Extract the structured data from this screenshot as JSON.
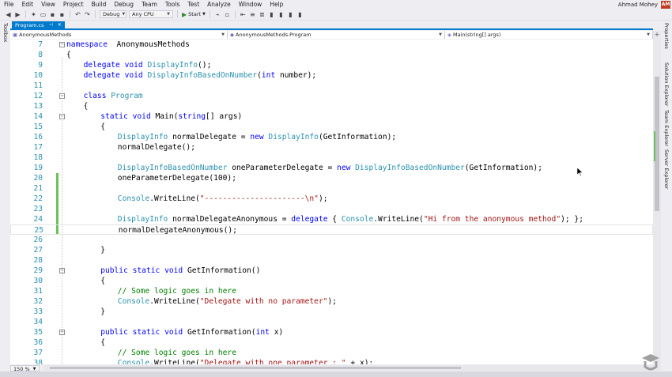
{
  "menu": {
    "items": [
      "File",
      "Edit",
      "View",
      "Project",
      "Build",
      "Debug",
      "Team",
      "Tools",
      "Test",
      "Analyze",
      "Window",
      "Help"
    ],
    "user_name": "Ahmad Mohey",
    "user_initials": "AM"
  },
  "toolbar": {
    "config": "Debug",
    "platform": "Any CPU",
    "start_label": "Start"
  },
  "side_tabs": {
    "left": [
      "Toolbox"
    ],
    "right": [
      "Properties",
      "Solution Explorer",
      "Team Explorer",
      "Server Explorer"
    ]
  },
  "document_tab": {
    "label": "Program.cs"
  },
  "nav": {
    "project": "AnonymousMethods",
    "type": "AnonymousMethods.Program",
    "member": "Main(string[] args)"
  },
  "editor": {
    "zoom": "150 %",
    "lines": [
      {
        "n": "7",
        "i": 0,
        "t": [
          [
            "kw",
            "namespace"
          ],
          [
            "",
            "  AnonymousMethods"
          ]
        ]
      },
      {
        "n": "8",
        "i": 0,
        "t": [
          [
            "",
            "{"
          ]
        ]
      },
      {
        "n": "9",
        "i": 1,
        "t": [
          [
            "kw",
            "delegate"
          ],
          [
            "",
            " "
          ],
          [
            "kw",
            "void"
          ],
          [
            "",
            " "
          ],
          [
            "ty",
            "DisplayInfo"
          ],
          [
            "",
            "();"
          ]
        ]
      },
      {
        "n": "10",
        "i": 1,
        "t": [
          [
            "kw",
            "delegate"
          ],
          [
            "",
            " "
          ],
          [
            "kw",
            "void"
          ],
          [
            "",
            " "
          ],
          [
            "ty",
            "DisplayInfoBasedOnNumber"
          ],
          [
            "",
            "("
          ],
          [
            "kw",
            "int"
          ],
          [
            "",
            " number);"
          ]
        ]
      },
      {
        "n": "11",
        "i": 0,
        "t": []
      },
      {
        "n": "12",
        "i": 1,
        "t": [
          [
            "kw",
            "class"
          ],
          [
            "",
            " "
          ],
          [
            "ty",
            "Program"
          ]
        ]
      },
      {
        "n": "13",
        "i": 1,
        "t": [
          [
            "",
            "{"
          ]
        ]
      },
      {
        "n": "14",
        "i": 2,
        "t": [
          [
            "kw",
            "static"
          ],
          [
            "",
            " "
          ],
          [
            "kw",
            "void"
          ],
          [
            "",
            " Main("
          ],
          [
            "kw",
            "string"
          ],
          [
            "",
            "[] args)"
          ]
        ]
      },
      {
        "n": "15",
        "i": 2,
        "t": [
          [
            "",
            "{"
          ]
        ]
      },
      {
        "n": "16",
        "i": 3,
        "t": [
          [
            "ty",
            "DisplayInfo"
          ],
          [
            "",
            " normalDelegate = "
          ],
          [
            "kw",
            "new"
          ],
          [
            "",
            " "
          ],
          [
            "ty",
            "DisplayInfo"
          ],
          [
            "",
            "(GetInformation);"
          ]
        ]
      },
      {
        "n": "17",
        "i": 3,
        "t": [
          [
            "",
            "normalDelegate();"
          ]
        ]
      },
      {
        "n": "18",
        "i": 0,
        "t": []
      },
      {
        "n": "19",
        "i": 3,
        "t": [
          [
            "ty",
            "DisplayInfoBasedOnNumber"
          ],
          [
            "",
            " oneParameterDelegate = "
          ],
          [
            "kw",
            "new"
          ],
          [
            "",
            " "
          ],
          [
            "ty",
            "DisplayInfoBasedOnNumber"
          ],
          [
            "",
            "(GetInformation);"
          ]
        ]
      },
      {
        "n": "20",
        "i": 3,
        "t": [
          [
            "",
            "oneParameterDelegate(100);"
          ]
        ]
      },
      {
        "n": "21",
        "i": 0,
        "t": []
      },
      {
        "n": "22",
        "i": 3,
        "t": [
          [
            "ty",
            "Console"
          ],
          [
            "",
            ".WriteLine("
          ],
          [
            "st",
            "\"----------------------\\n\""
          ],
          [
            "",
            ");"
          ]
        ]
      },
      {
        "n": "23",
        "i": 0,
        "t": []
      },
      {
        "n": "24",
        "i": 3,
        "t": [
          [
            "ty",
            "DisplayInfo"
          ],
          [
            "",
            " normalDelegateAnonymous = "
          ],
          [
            "kw",
            "delegate"
          ],
          [
            "",
            " { "
          ],
          [
            "ty",
            "Console"
          ],
          [
            "",
            ".WriteLine("
          ],
          [
            "st",
            "\"Hi from the anonymous method\""
          ],
          [
            "",
            "); };"
          ]
        ]
      },
      {
        "n": "25",
        "i": 3,
        "t": [
          [
            "",
            "normalDelegateAnonymous();"
          ]
        ]
      },
      {
        "n": "26",
        "i": 0,
        "t": []
      },
      {
        "n": "27",
        "i": 2,
        "t": [
          [
            "",
            "}"
          ]
        ]
      },
      {
        "n": "28",
        "i": 0,
        "t": []
      },
      {
        "n": "29",
        "i": 2,
        "t": [
          [
            "kw",
            "public"
          ],
          [
            "",
            " "
          ],
          [
            "kw",
            "static"
          ],
          [
            "",
            " "
          ],
          [
            "kw",
            "void"
          ],
          [
            "",
            " GetInformation()"
          ]
        ]
      },
      {
        "n": "30",
        "i": 2,
        "t": [
          [
            "",
            "{"
          ]
        ]
      },
      {
        "n": "31",
        "i": 3,
        "t": [
          [
            "cm",
            "// Some logic goes in here"
          ]
        ]
      },
      {
        "n": "32",
        "i": 3,
        "t": [
          [
            "ty",
            "Console"
          ],
          [
            "",
            ".WriteLine("
          ],
          [
            "st",
            "\"Delegate with no parameter\""
          ],
          [
            "",
            ");"
          ]
        ]
      },
      {
        "n": "33",
        "i": 2,
        "t": [
          [
            "",
            "}"
          ]
        ]
      },
      {
        "n": "34",
        "i": 0,
        "t": []
      },
      {
        "n": "35",
        "i": 2,
        "t": [
          [
            "kw",
            "public"
          ],
          [
            "",
            " "
          ],
          [
            "kw",
            "static"
          ],
          [
            "",
            " "
          ],
          [
            "kw",
            "void"
          ],
          [
            "",
            " GetInformation("
          ],
          [
            "kw",
            "int"
          ],
          [
            "",
            " x)"
          ]
        ]
      },
      {
        "n": "36",
        "i": 2,
        "t": [
          [
            "",
            "{"
          ]
        ]
      },
      {
        "n": "37",
        "i": 3,
        "t": [
          [
            "cm",
            "// Some logic goes in here"
          ]
        ]
      },
      {
        "n": "38",
        "i": 3,
        "t": [
          [
            "ty",
            "Console"
          ],
          [
            "",
            ".WriteLine("
          ],
          [
            "st",
            "\"Delegate with one parameter : \""
          ],
          [
            "",
            " + x);"
          ]
        ]
      }
    ],
    "current_line": "25",
    "changed_lines": [
      "20",
      "21",
      "22",
      "23",
      "24",
      "25"
    ],
    "outline_lines": [
      "7",
      "12",
      "14",
      "29",
      "35"
    ]
  },
  "colors": {
    "accent": "#007acc",
    "keyword": "#0000ff",
    "type": "#2b91af",
    "string": "#a31515",
    "comment": "#008000",
    "change": "#6ac259"
  }
}
